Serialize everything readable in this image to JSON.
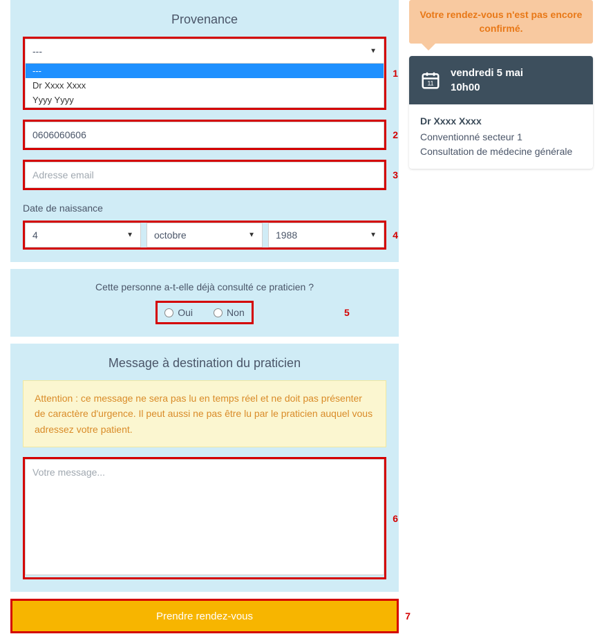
{
  "sections": {
    "provenance_title": "Provenance",
    "message_title": "Message à destination du praticien"
  },
  "provenance_select": {
    "value": "---",
    "options": [
      "---",
      "Dr Xxxx Xxxx",
      "Yyyy Yyyy"
    ]
  },
  "phone": {
    "value": "0606060606"
  },
  "email": {
    "placeholder": "Adresse email"
  },
  "dob": {
    "label": "Date de naissance",
    "day": "4",
    "month": "octobre",
    "year": "1988"
  },
  "consult_question": "Cette personne a-t-elle déjà consulté ce praticien ?",
  "radio": {
    "yes": "Oui",
    "no": "Non"
  },
  "warning_text": "Attention : ce message ne sera pas lu en temps réel et ne doit pas présenter de caractère d'urgence. Il peut aussi ne pas être lu par le praticien auquel vous adressez votre patient.",
  "message": {
    "placeholder": "Votre message..."
  },
  "submit_label": "Prendre rendez-vous",
  "sidebar": {
    "alert": "Votre rendez-vous n'est pas encore confirmé.",
    "date_line": "vendredi 5 mai",
    "time_line": "10h00",
    "doctor": "Dr Xxxx Xxxx",
    "sector": "Conventionné secteur 1",
    "consult_type": "Consultation de médecine générale"
  },
  "highlight_numbers": {
    "n1": "1",
    "n2": "2",
    "n3": "3",
    "n4": "4",
    "n5": "5",
    "n6": "6",
    "n7": "7"
  }
}
